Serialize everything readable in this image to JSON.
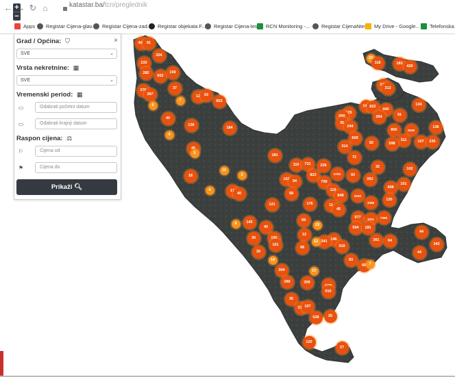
{
  "browser": {
    "url_domain": "katastar.ba/",
    "url_path": "tcn/preglednik",
    "bookmarks": [
      {
        "label": "Apps",
        "color": "#e8453c"
      },
      {
        "label": "Registar Cijena-glav...",
        "color": "#555555"
      },
      {
        "label": "Registar Cijena-zad...",
        "color": "#555555"
      },
      {
        "label": "Registar objekata F...",
        "color": "#222222"
      },
      {
        "label": "Registar Cijena-test",
        "color": "#555555"
      },
      {
        "label": "RCN Monitoring -...",
        "color": "#1e8e3e"
      },
      {
        "label": "Registar CijenaNtest",
        "color": "#555555"
      },
      {
        "label": "My Drive - Google...",
        "color": "#f4b400"
      },
      {
        "label": "Telefonska",
        "color": "#1e8e3e"
      }
    ]
  },
  "zoom": {
    "in_label": "+",
    "out_label": "−"
  },
  "filter_panel": {
    "city_label": "Grad / Općina:",
    "city_value": "SVE",
    "property_type_label": "Vrsta nekretnine:",
    "property_type_value": "SVE",
    "period_label": "Vremenski period:",
    "start_date_placeholder": "Odabrati početni datum",
    "end_date_placeholder": "Odabrati krajnji datum",
    "price_range_label": "Raspon cijena:",
    "price_from_placeholder": "Cijena od",
    "price_to_placeholder": "Cijena do",
    "submit_label": "Prikaži",
    "close_label": "×"
  },
  "icons": {
    "shield": "shield-icon",
    "building": "building-icon",
    "calendar": "calendar-icon",
    "scale": "scale-icon",
    "flag_start": "flag-icon",
    "flag_finish": "checkered-flag-icon",
    "search": "search-icon"
  },
  "colors": {
    "cluster_big": "#e8520f",
    "cluster_small": "#f7941d",
    "map_land": "#3a3f3d",
    "button_dark": "#343a40"
  },
  "clusters": [
    {
      "label": "483",
      "size": "big"
    },
    {
      "label": "91",
      "size": "big"
    },
    {
      "label": "324",
      "size": "big"
    },
    {
      "label": "233",
      "size": "big"
    },
    {
      "label": "282",
      "size": "big"
    },
    {
      "label": "652",
      "size": "big"
    },
    {
      "label": "159",
      "size": "big"
    },
    {
      "label": "376",
      "size": "big"
    },
    {
      "label": "397",
      "size": "big"
    },
    {
      "label": "37",
      "size": "big"
    },
    {
      "label": "7",
      "size": "small"
    },
    {
      "label": "12",
      "size": "big"
    },
    {
      "label": "63",
      "size": "big"
    },
    {
      "label": "853",
      "size": "big"
    },
    {
      "label": "6",
      "size": "small"
    },
    {
      "label": "40",
      "size": "big"
    },
    {
      "label": "136",
      "size": "big"
    },
    {
      "label": "184",
      "size": "big"
    },
    {
      "label": "4",
      "size": "small"
    },
    {
      "label": "45",
      "size": "big"
    },
    {
      "label": "5",
      "size": "small"
    },
    {
      "label": "181",
      "size": "big"
    },
    {
      "label": "16",
      "size": "small"
    },
    {
      "label": "3",
      "size": "small"
    },
    {
      "label": "18",
      "size": "big"
    },
    {
      "label": "4",
      "size": "small"
    },
    {
      "label": "17",
      "size": "big"
    },
    {
      "label": "40",
      "size": "big"
    },
    {
      "label": "121",
      "size": "big"
    },
    {
      "label": "8",
      "size": "small"
    },
    {
      "label": "145",
      "size": "big"
    },
    {
      "label": "30",
      "size": "big"
    },
    {
      "label": "40",
      "size": "big"
    },
    {
      "label": "190",
      "size": "big"
    },
    {
      "label": "151",
      "size": "big"
    },
    {
      "label": "39",
      "size": "big"
    },
    {
      "label": "14",
      "size": "small"
    },
    {
      "label": "304",
      "size": "big"
    },
    {
      "label": "288",
      "size": "big"
    },
    {
      "label": "35",
      "size": "big"
    },
    {
      "label": "338",
      "size": "big"
    },
    {
      "label": "107",
      "size": "big"
    },
    {
      "label": "628",
      "size": "big"
    },
    {
      "label": "25",
      "size": "big"
    },
    {
      "label": "120",
      "size": "big"
    },
    {
      "label": "27",
      "size": "big"
    },
    {
      "label": "23",
      "size": "small"
    },
    {
      "label": "118",
      "size": "big"
    },
    {
      "label": "183",
      "size": "big"
    },
    {
      "label": "420",
      "size": "big"
    },
    {
      "label": "277",
      "size": "big"
    },
    {
      "label": "313",
      "size": "big"
    },
    {
      "label": "143",
      "size": "big"
    },
    {
      "label": "822",
      "size": "big"
    },
    {
      "label": "440",
      "size": "big"
    },
    {
      "label": "134",
      "size": "big"
    },
    {
      "label": "264",
      "size": "big"
    },
    {
      "label": "91",
      "size": "big"
    },
    {
      "label": "525",
      "size": "big"
    },
    {
      "label": "990",
      "size": "big"
    },
    {
      "label": "35",
      "size": "big"
    },
    {
      "label": "244",
      "size": "big"
    },
    {
      "label": "850",
      "size": "big"
    },
    {
      "label": "2530",
      "size": "big"
    },
    {
      "label": "136",
      "size": "big"
    },
    {
      "label": "609",
      "size": "big"
    },
    {
      "label": "311",
      "size": "big"
    },
    {
      "label": "107",
      "size": "big"
    },
    {
      "label": "235",
      "size": "big"
    },
    {
      "label": "314",
      "size": "big"
    },
    {
      "label": "82",
      "size": "big"
    },
    {
      "label": "598",
      "size": "big"
    },
    {
      "label": "72",
      "size": "big"
    },
    {
      "label": "110",
      "size": "big"
    },
    {
      "label": "731",
      "size": "big"
    },
    {
      "label": "226",
      "size": "big"
    },
    {
      "label": "32",
      "size": "big"
    },
    {
      "label": "102",
      "size": "big"
    },
    {
      "label": "102",
      "size": "big"
    },
    {
      "label": "94",
      "size": "big"
    },
    {
      "label": "823",
      "size": "big"
    },
    {
      "label": "2703",
      "size": "big"
    },
    {
      "label": "93",
      "size": "big"
    },
    {
      "label": "262",
      "size": "big"
    },
    {
      "label": "799",
      "size": "big"
    },
    {
      "label": "408",
      "size": "big"
    },
    {
      "label": "101",
      "size": "big"
    },
    {
      "label": "58",
      "size": "big"
    },
    {
      "label": "119",
      "size": "big"
    },
    {
      "label": "848",
      "size": "big"
    },
    {
      "label": "2192",
      "size": "big"
    },
    {
      "label": "1088",
      "size": "big"
    },
    {
      "label": "120",
      "size": "big"
    },
    {
      "label": "176",
      "size": "big"
    },
    {
      "label": "11",
      "size": "big"
    },
    {
      "label": "45",
      "size": "big"
    },
    {
      "label": "977",
      "size": "big"
    },
    {
      "label": "1011",
      "size": "big"
    },
    {
      "label": "7369",
      "size": "big"
    },
    {
      "label": "69",
      "size": "big"
    },
    {
      "label": "23",
      "size": "small"
    },
    {
      "label": "594",
      "size": "big"
    },
    {
      "label": "181",
      "size": "big"
    },
    {
      "label": "12",
      "size": "big"
    },
    {
      "label": "146",
      "size": "big"
    },
    {
      "label": "341",
      "size": "big"
    },
    {
      "label": "361",
      "size": "big"
    },
    {
      "label": "64",
      "size": "big"
    },
    {
      "label": "44",
      "size": "big"
    },
    {
      "label": "343",
      "size": "big"
    },
    {
      "label": "12",
      "size": "small"
    },
    {
      "label": "98",
      "size": "big"
    },
    {
      "label": "319",
      "size": "big"
    },
    {
      "label": "44",
      "size": "big"
    },
    {
      "label": "68",
      "size": "big"
    },
    {
      "label": "83",
      "size": "big"
    },
    {
      "label": "7",
      "size": "small"
    },
    {
      "label": "15",
      "size": "small"
    },
    {
      "label": "309",
      "size": "big"
    },
    {
      "label": "1498",
      "size": "big"
    },
    {
      "label": "910",
      "size": "big"
    }
  ]
}
